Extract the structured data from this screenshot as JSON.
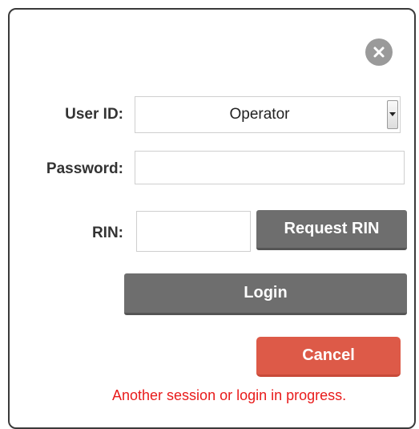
{
  "dialog": {
    "close_icon": "close-x-icon",
    "user_id": {
      "label": "User ID:",
      "selected": "Operator"
    },
    "password": {
      "label": "Password:",
      "value": ""
    },
    "rin": {
      "label": "RIN:",
      "value": "",
      "request_button": "Request RIN"
    },
    "login_button": "Login",
    "cancel_button": "Cancel",
    "error_message": "Another session or login in progress."
  },
  "colors": {
    "close_button": "#9a9a9a",
    "gray_button": "#6e6e6e",
    "cancel_button": "#dd5a48",
    "error_text": "#e81b1b",
    "border": "#3a3a3a"
  }
}
